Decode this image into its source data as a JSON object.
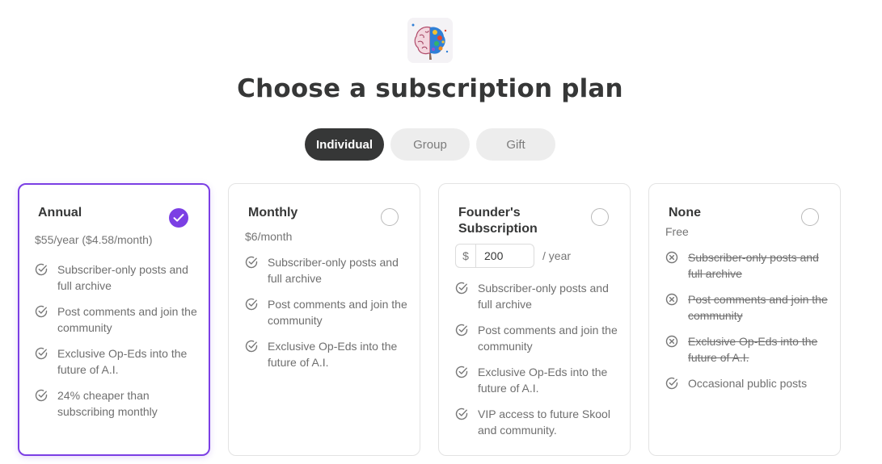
{
  "header": {
    "title": "Choose a subscription plan"
  },
  "tabs": [
    {
      "label": "Individual",
      "active": true
    },
    {
      "label": "Group",
      "active": false
    },
    {
      "label": "Gift",
      "active": false
    }
  ],
  "plans": [
    {
      "name": "Annual",
      "price": "$55/year ($4.58/month)",
      "selected": true,
      "features": [
        "Subscriber-only posts and full archive",
        "Post comments and join the community",
        "Exclusive Op-Eds into the future of A.I.",
        "24% cheaper than subscribing monthly"
      ]
    },
    {
      "name": "Monthly",
      "price": "$6/month",
      "selected": false,
      "features": [
        "Subscriber-only posts and full archive",
        "Post comments and join the community",
        "Exclusive Op-Eds into the future of A.I."
      ]
    },
    {
      "name": "Founder's Subscription",
      "selected": false,
      "currency": "$",
      "amount": "200",
      "per": "/ year",
      "features": [
        "Subscriber-only posts and full archive",
        "Post comments and join the community",
        "Exclusive Op-Eds into the future of A.I.",
        "VIP access to future Skool and community."
      ]
    },
    {
      "name": "None",
      "price": "Free",
      "selected": false,
      "features_excluded": [
        "Subscriber-only posts and full archive",
        "Post comments and join the community",
        "Exclusive Op-Eds into the future of A.I."
      ],
      "features": [
        "Occasional public posts"
      ]
    }
  ],
  "colors": {
    "accent": "#7b3fe4",
    "dark": "#363737",
    "tab_inactive": "#ededed"
  },
  "icons": {
    "included": "check-circle-icon",
    "excluded": "x-circle-icon",
    "selected": "checkmark-icon",
    "logo": "brain-logo"
  }
}
